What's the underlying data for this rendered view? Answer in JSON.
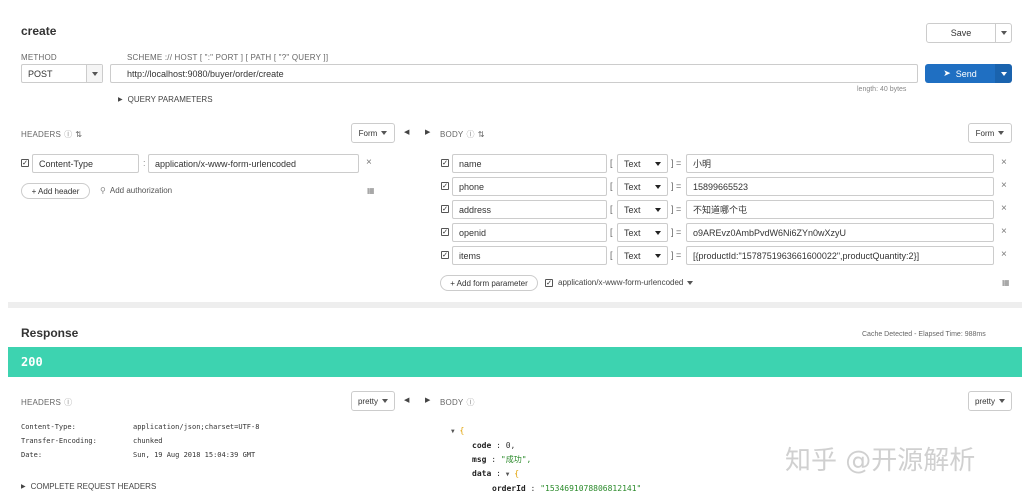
{
  "request": {
    "name": "create",
    "save_label": "Save",
    "method_label": "METHOD",
    "method": "POST",
    "url_label": "SCHEME :// HOST [ \":\" PORT ] [ PATH [ \"?\" QUERY ]]",
    "url": "http://localhost:9080/buyer/order/create",
    "send_label": "Send",
    "length": "length: 40 bytes",
    "query_params_label": "QUERY PARAMETERS"
  },
  "req_headers": {
    "title": "HEADERS",
    "mode": "Form",
    "rows": [
      {
        "key": "Content-Type",
        "value": "application/x-www-form-urlencoded"
      }
    ],
    "add_header": "+ Add header",
    "add_auth": "Add authorization"
  },
  "req_body": {
    "title": "BODY",
    "mode": "Form",
    "rows": [
      {
        "key": "name",
        "type": "Text",
        "value": "小明"
      },
      {
        "key": "phone",
        "type": "Text",
        "value": "15899665523"
      },
      {
        "key": "address",
        "type": "Text",
        "value": "不知道哪个屯"
      },
      {
        "key": "openid",
        "type": "Text",
        "value": "o9AREvz0AmbPvdW6Ni6ZYn0wXzyU"
      },
      {
        "key": "items",
        "type": "Text",
        "value": "[{productId:\"1578751963661600022\",productQuantity:2}]"
      }
    ],
    "add_param": "+ Add form parameter",
    "encoding": "application/x-www-form-urlencoded"
  },
  "response": {
    "title": "Response",
    "cache": "Cache Detected - Elapsed Time: 988ms",
    "status": "200",
    "status_color": "#3dd3b0",
    "headers_title": "HEADERS",
    "headers_mode": "pretty",
    "headers": [
      {
        "key": "Content-Type:",
        "value": "application/json;charset=UTF-8"
      },
      {
        "key": "Transfer-Encoding:",
        "value": "chunked"
      },
      {
        "key": "Date:",
        "value": "Sun, 19 Aug 2018 15:04:39 GMT"
      }
    ],
    "complete_headers": "COMPLETE REQUEST HEADERS",
    "body_title": "BODY",
    "body_mode": "pretty",
    "json": {
      "code_key": "code",
      "code_val": "0,",
      "msg_key": "msg",
      "msg_val": "\"成功\",",
      "data_key": "data",
      "orderid_key": "orderId",
      "orderid_val": "\"1534691078806812141\""
    }
  },
  "watermark": "知乎 @开源解析",
  "accent": "#1f6fc2"
}
